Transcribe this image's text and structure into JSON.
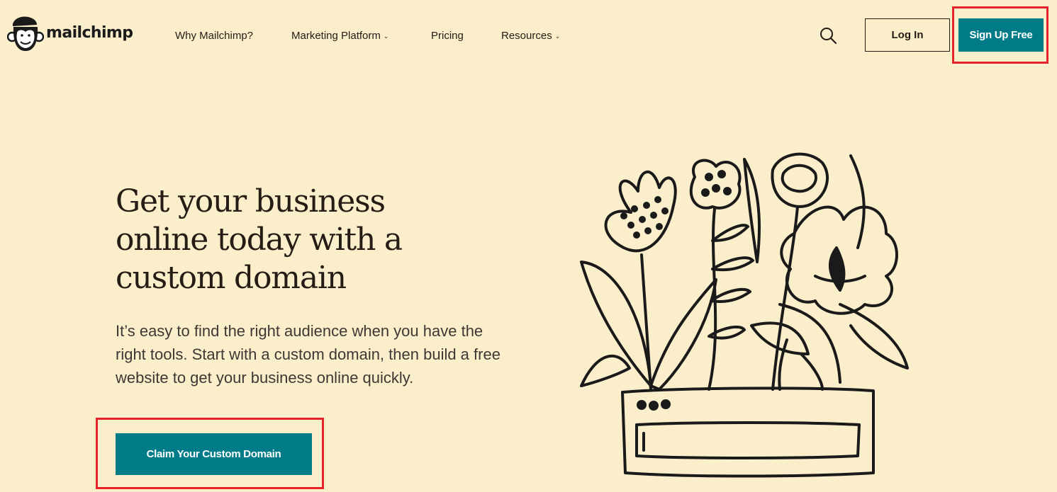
{
  "brand": {
    "name": "mailchimp",
    "icon": "freddie-monkey-icon",
    "logo_color": "#1a1a1a"
  },
  "nav": {
    "items": [
      {
        "label": "Why Mailchimp?",
        "has_dropdown": false
      },
      {
        "label": "Marketing Platform",
        "has_dropdown": true
      },
      {
        "label": "Pricing",
        "has_dropdown": false
      },
      {
        "label": "Resources",
        "has_dropdown": true
      }
    ],
    "dropdown_glyph": "⌄"
  },
  "header_actions": {
    "search_icon": "search-icon",
    "login_label": "Log In",
    "signup_label": "Sign Up Free"
  },
  "hero": {
    "title": "Get your business online today with a custom domain",
    "body": "It’s easy to find the right audience when you have the right tools. Start with a custom domain, then build a free website to get your business online quickly.",
    "cta_label": "Claim Your Custom Domain",
    "illustration": "flowers-growing-from-browser-window-illustration"
  },
  "colors": {
    "background": "#fbeecb",
    "primary_button": "#007c89",
    "text": "#241c15",
    "highlight_box": "#e4222a"
  }
}
